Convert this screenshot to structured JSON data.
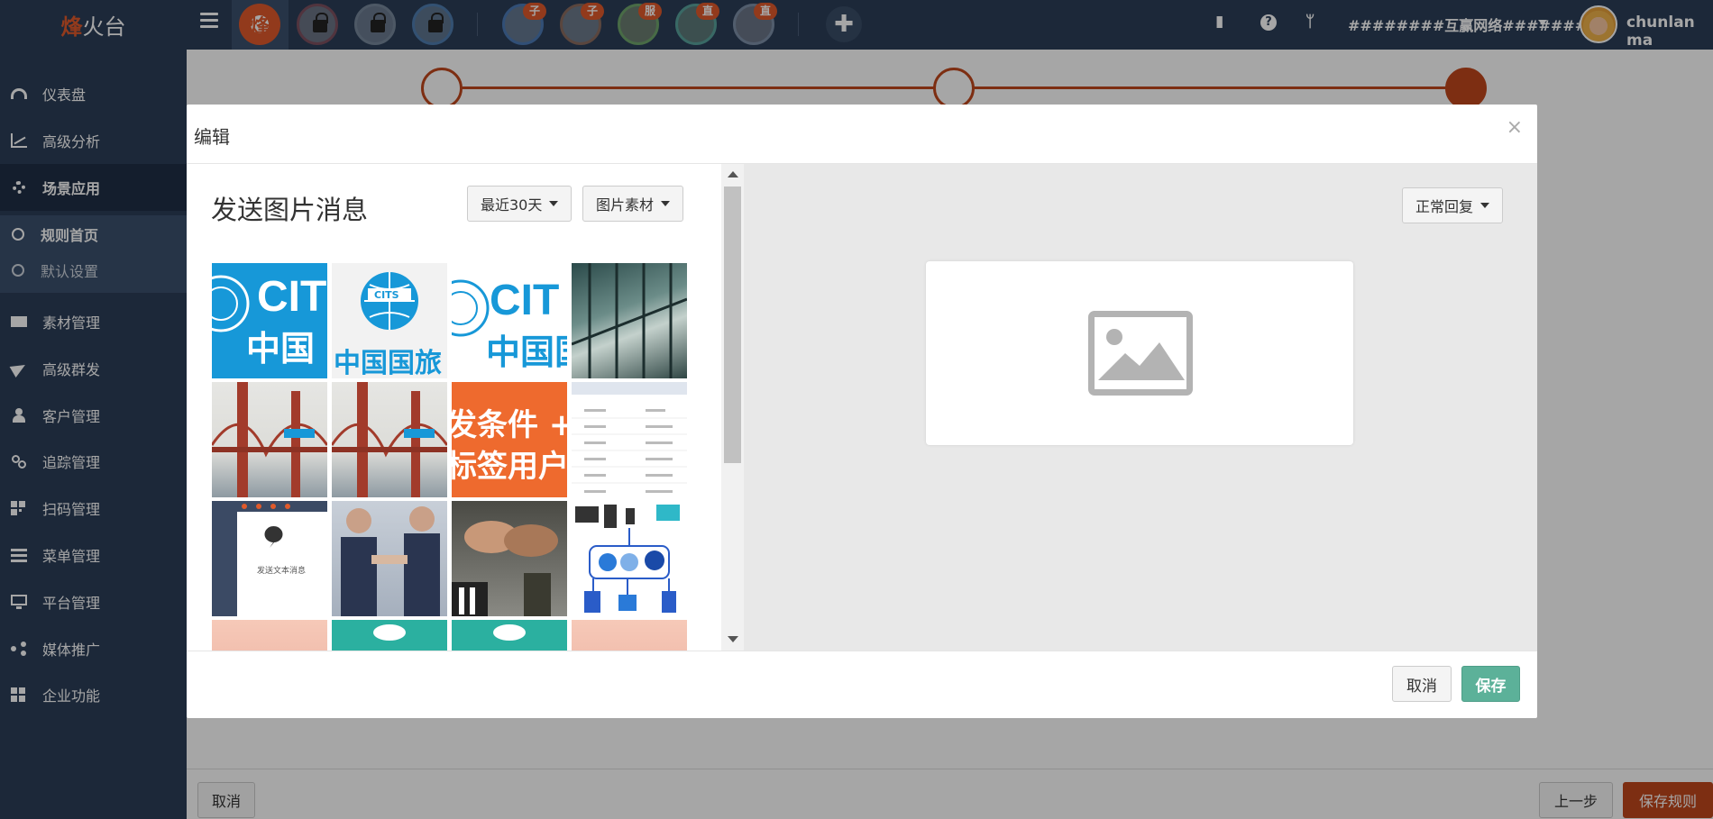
{
  "brand": {
    "part1": "烽",
    "part2": "火台"
  },
  "topbar": {
    "accounts": [
      {
        "badge": ""
      },
      {
        "badge": ""
      },
      {
        "badge": ""
      },
      {
        "badge": ""
      },
      {
        "badge": "子"
      },
      {
        "badge": "子"
      },
      {
        "badge": "服"
      },
      {
        "badge": "直"
      },
      {
        "badge": "直"
      }
    ],
    "add_symbol": "✚",
    "org_name": "########互赢网络#######",
    "username": "chunlan ma"
  },
  "sidebar": {
    "items": [
      {
        "label": "仪表盘",
        "icon": "dashboard-icon"
      },
      {
        "label": "高级分析",
        "icon": "line-chart-icon"
      },
      {
        "label": "场景应用",
        "icon": "gear-icon"
      },
      {
        "label": "素材管理",
        "icon": "envelope-icon"
      },
      {
        "label": "高级群发",
        "icon": "send-icon"
      },
      {
        "label": "客户管理",
        "icon": "user-icon"
      },
      {
        "label": "追踪管理",
        "icon": "link-icon"
      },
      {
        "label": "扫码管理",
        "icon": "qrcode-icon"
      },
      {
        "label": "菜单管理",
        "icon": "list-icon"
      },
      {
        "label": "平台管理",
        "icon": "monitor-icon"
      },
      {
        "label": "媒体推广",
        "icon": "share-icon"
      },
      {
        "label": "企业功能",
        "icon": "grid-icon"
      }
    ],
    "subitems": [
      {
        "label": "规则首页"
      },
      {
        "label": "默认设置"
      }
    ]
  },
  "page": {
    "cancel_label": "取消",
    "prev_label": "上一步",
    "save_rule_label": "保存规则"
  },
  "modal": {
    "title": "编辑",
    "close": "×",
    "pane_title": "发送图片消息",
    "range_dropdown": "最近30天",
    "source_dropdown": "图片素材",
    "reply_dropdown": "正常回复",
    "cancel_label": "取消",
    "save_label": "保存",
    "thumbs": [
      {
        "kind": "cits-crop-left",
        "text_big": "CIT",
        "text_cn": "中国"
      },
      {
        "kind": "cits-full",
        "logo": "CITS",
        "text_cn": "中国国旅"
      },
      {
        "kind": "cits-crop-mid",
        "text_big": "CIT",
        "text_cn": "中国国"
      },
      {
        "kind": "photo-glass"
      },
      {
        "kind": "photo-bridge"
      },
      {
        "kind": "photo-bridge"
      },
      {
        "kind": "orange-text",
        "line1": "发条件 +",
        "line2": "标签用户"
      },
      {
        "kind": "screenshot-table"
      },
      {
        "kind": "screenshot-chat",
        "caption": "发送文本消息"
      },
      {
        "kind": "photo-handshake"
      },
      {
        "kind": "photo-fists"
      },
      {
        "kind": "network-diagram"
      },
      {
        "kind": "photo-pink"
      },
      {
        "kind": "teal-cloud"
      },
      {
        "kind": "teal-cloud"
      },
      {
        "kind": "photo-pink"
      }
    ]
  }
}
